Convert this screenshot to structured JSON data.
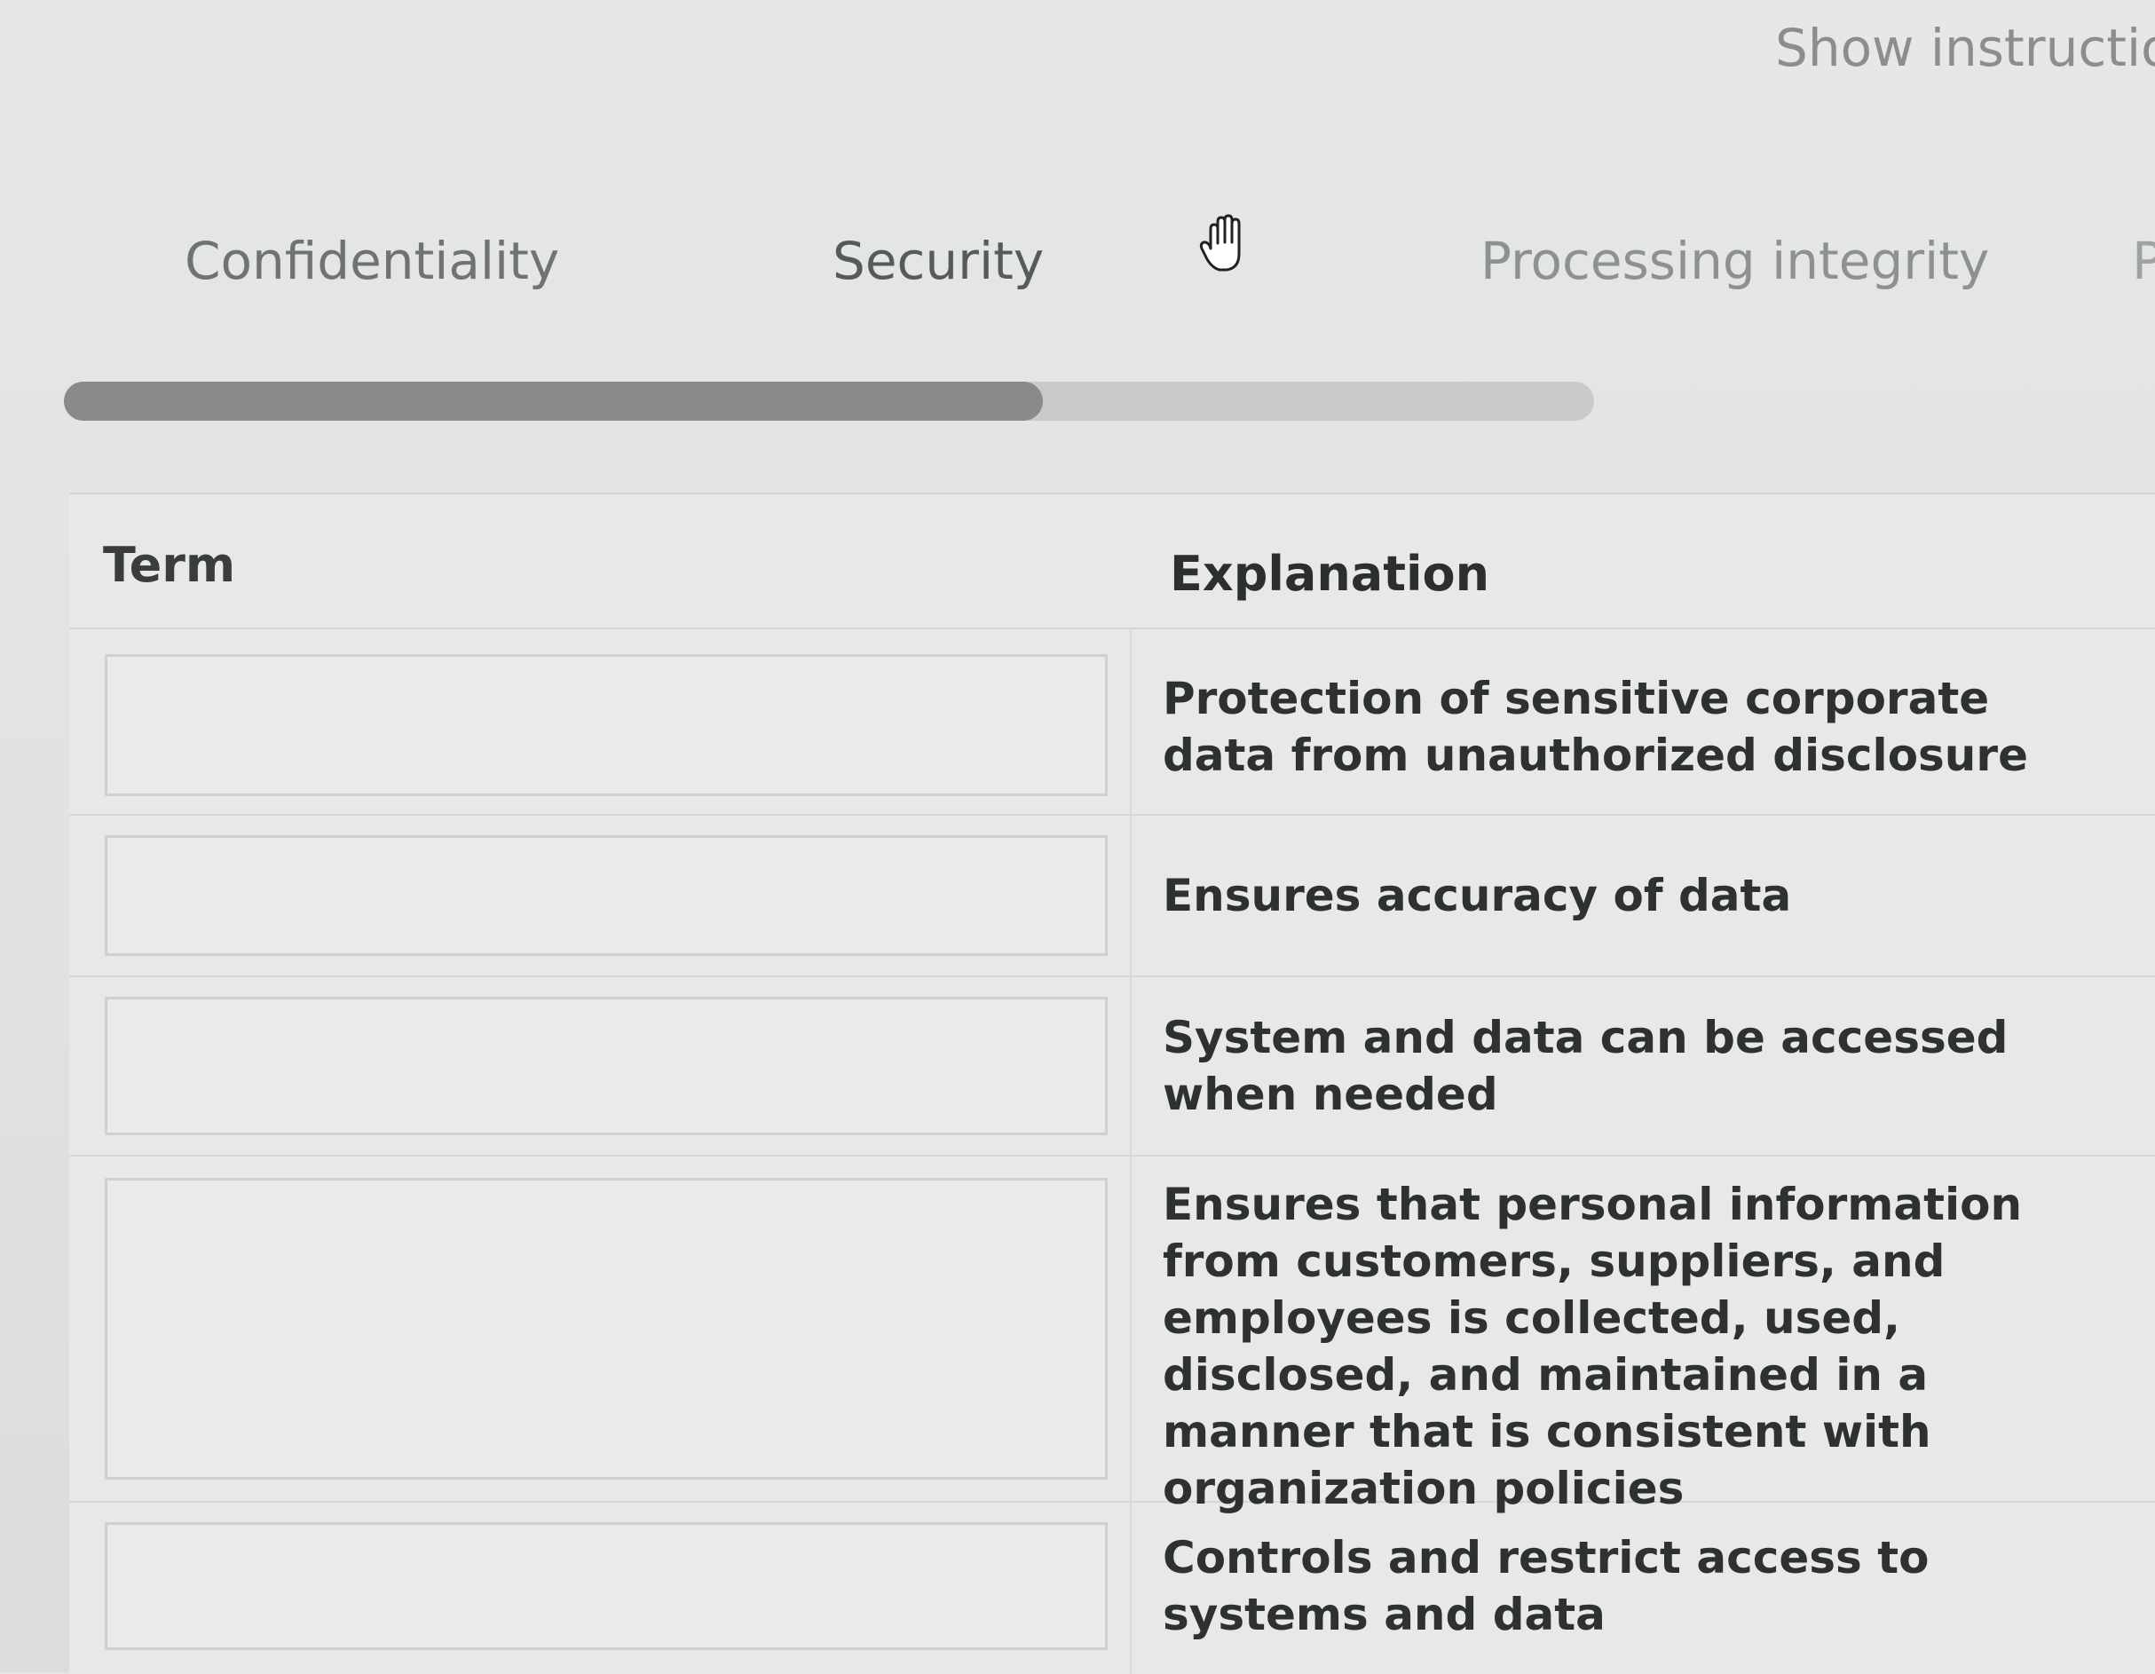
{
  "header": {
    "show_instructions": "Show instructio"
  },
  "term_bank": {
    "items": [
      {
        "label": "Confidentiality"
      },
      {
        "label": "Security"
      },
      {
        "label": "Processing integrity"
      },
      {
        "label": "P"
      }
    ]
  },
  "scrollbar": {
    "position_fraction": 0.0,
    "visible_fraction": 0.64
  },
  "table": {
    "headers": {
      "term": "Term",
      "explanation": "Explanation"
    },
    "rows": [
      {
        "term": "",
        "explanation": "Protection of sensitive corporate data from unauthorized disclosure"
      },
      {
        "term": "",
        "explanation": "Ensures accuracy of data"
      },
      {
        "term": "",
        "explanation": "System and data can be accessed when needed"
      },
      {
        "term": "",
        "explanation": "Ensures that personal information from customers, suppliers, and employees is collected, used, disclosed, and maintained in a manner that is consistent with organization policies"
      },
      {
        "term": "",
        "explanation": "Controls and restrict access to systems and data"
      }
    ]
  },
  "icons": {
    "cursor": "hand-grab-cursor-icon"
  }
}
